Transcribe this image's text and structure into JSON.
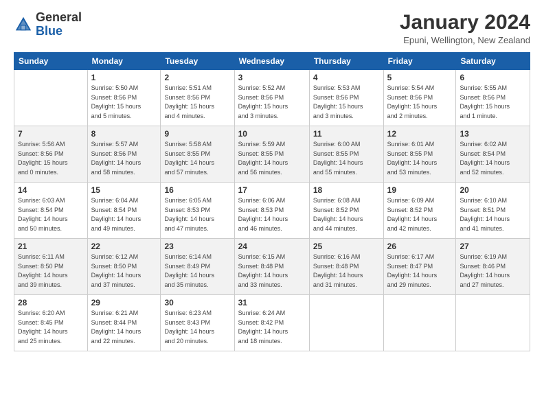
{
  "logo": {
    "general": "General",
    "blue": "Blue"
  },
  "header": {
    "month_year": "January 2024",
    "location": "Epuni, Wellington, New Zealand"
  },
  "days_of_week": [
    "Sunday",
    "Monday",
    "Tuesday",
    "Wednesday",
    "Thursday",
    "Friday",
    "Saturday"
  ],
  "weeks": [
    [
      {
        "day": "",
        "info": ""
      },
      {
        "day": "1",
        "info": "Sunrise: 5:50 AM\nSunset: 8:56 PM\nDaylight: 15 hours\nand 5 minutes."
      },
      {
        "day": "2",
        "info": "Sunrise: 5:51 AM\nSunset: 8:56 PM\nDaylight: 15 hours\nand 4 minutes."
      },
      {
        "day": "3",
        "info": "Sunrise: 5:52 AM\nSunset: 8:56 PM\nDaylight: 15 hours\nand 3 minutes."
      },
      {
        "day": "4",
        "info": "Sunrise: 5:53 AM\nSunset: 8:56 PM\nDaylight: 15 hours\nand 3 minutes."
      },
      {
        "day": "5",
        "info": "Sunrise: 5:54 AM\nSunset: 8:56 PM\nDaylight: 15 hours\nand 2 minutes."
      },
      {
        "day": "6",
        "info": "Sunrise: 5:55 AM\nSunset: 8:56 PM\nDaylight: 15 hours\nand 1 minute."
      }
    ],
    [
      {
        "day": "7",
        "info": "Sunrise: 5:56 AM\nSunset: 8:56 PM\nDaylight: 15 hours\nand 0 minutes."
      },
      {
        "day": "8",
        "info": "Sunrise: 5:57 AM\nSunset: 8:56 PM\nDaylight: 14 hours\nand 58 minutes."
      },
      {
        "day": "9",
        "info": "Sunrise: 5:58 AM\nSunset: 8:55 PM\nDaylight: 14 hours\nand 57 minutes."
      },
      {
        "day": "10",
        "info": "Sunrise: 5:59 AM\nSunset: 8:55 PM\nDaylight: 14 hours\nand 56 minutes."
      },
      {
        "day": "11",
        "info": "Sunrise: 6:00 AM\nSunset: 8:55 PM\nDaylight: 14 hours\nand 55 minutes."
      },
      {
        "day": "12",
        "info": "Sunrise: 6:01 AM\nSunset: 8:55 PM\nDaylight: 14 hours\nand 53 minutes."
      },
      {
        "day": "13",
        "info": "Sunrise: 6:02 AM\nSunset: 8:54 PM\nDaylight: 14 hours\nand 52 minutes."
      }
    ],
    [
      {
        "day": "14",
        "info": "Sunrise: 6:03 AM\nSunset: 8:54 PM\nDaylight: 14 hours\nand 50 minutes."
      },
      {
        "day": "15",
        "info": "Sunrise: 6:04 AM\nSunset: 8:54 PM\nDaylight: 14 hours\nand 49 minutes."
      },
      {
        "day": "16",
        "info": "Sunrise: 6:05 AM\nSunset: 8:53 PM\nDaylight: 14 hours\nand 47 minutes."
      },
      {
        "day": "17",
        "info": "Sunrise: 6:06 AM\nSunset: 8:53 PM\nDaylight: 14 hours\nand 46 minutes."
      },
      {
        "day": "18",
        "info": "Sunrise: 6:08 AM\nSunset: 8:52 PM\nDaylight: 14 hours\nand 44 minutes."
      },
      {
        "day": "19",
        "info": "Sunrise: 6:09 AM\nSunset: 8:52 PM\nDaylight: 14 hours\nand 42 minutes."
      },
      {
        "day": "20",
        "info": "Sunrise: 6:10 AM\nSunset: 8:51 PM\nDaylight: 14 hours\nand 41 minutes."
      }
    ],
    [
      {
        "day": "21",
        "info": "Sunrise: 6:11 AM\nSunset: 8:50 PM\nDaylight: 14 hours\nand 39 minutes."
      },
      {
        "day": "22",
        "info": "Sunrise: 6:12 AM\nSunset: 8:50 PM\nDaylight: 14 hours\nand 37 minutes."
      },
      {
        "day": "23",
        "info": "Sunrise: 6:14 AM\nSunset: 8:49 PM\nDaylight: 14 hours\nand 35 minutes."
      },
      {
        "day": "24",
        "info": "Sunrise: 6:15 AM\nSunset: 8:48 PM\nDaylight: 14 hours\nand 33 minutes."
      },
      {
        "day": "25",
        "info": "Sunrise: 6:16 AM\nSunset: 8:48 PM\nDaylight: 14 hours\nand 31 minutes."
      },
      {
        "day": "26",
        "info": "Sunrise: 6:17 AM\nSunset: 8:47 PM\nDaylight: 14 hours\nand 29 minutes."
      },
      {
        "day": "27",
        "info": "Sunrise: 6:19 AM\nSunset: 8:46 PM\nDaylight: 14 hours\nand 27 minutes."
      }
    ],
    [
      {
        "day": "28",
        "info": "Sunrise: 6:20 AM\nSunset: 8:45 PM\nDaylight: 14 hours\nand 25 minutes."
      },
      {
        "day": "29",
        "info": "Sunrise: 6:21 AM\nSunset: 8:44 PM\nDaylight: 14 hours\nand 22 minutes."
      },
      {
        "day": "30",
        "info": "Sunrise: 6:23 AM\nSunset: 8:43 PM\nDaylight: 14 hours\nand 20 minutes."
      },
      {
        "day": "31",
        "info": "Sunrise: 6:24 AM\nSunset: 8:42 PM\nDaylight: 14 hours\nand 18 minutes."
      },
      {
        "day": "",
        "info": ""
      },
      {
        "day": "",
        "info": ""
      },
      {
        "day": "",
        "info": ""
      }
    ]
  ]
}
